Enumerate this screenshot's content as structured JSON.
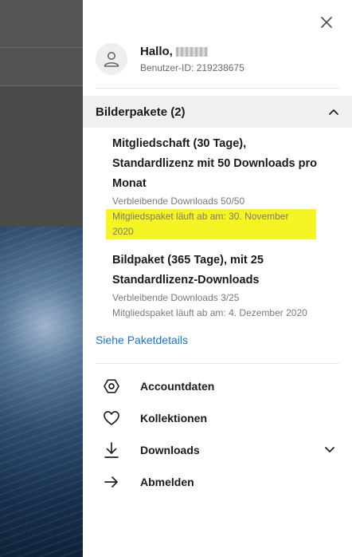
{
  "user": {
    "greeting": "Hallo,",
    "id_text": "Benutzer-ID: 219238675"
  },
  "packages": {
    "title": "Bilderpakete (2)",
    "items": [
      {
        "name": "Mitgliedschaft (30 Tage), Standardlizenz mit 50 Downloads pro Monat",
        "remaining": "Verbleibende Downloads 50/50",
        "expiry": "Mitgliedspaket läuft ab am: 30. November 2020"
      },
      {
        "name": "Bildpaket (365 Tage), mit 25 Standardlizenz-Downloads",
        "remaining": "Verbleibende Downloads 3/25",
        "expiry": "Mitgliedspaket läuft ab am: 4. Dezember 2020"
      }
    ],
    "details_link": "Siehe Paketdetails"
  },
  "menu": [
    {
      "label": "Accountdaten",
      "icon": "hexagon-icon"
    },
    {
      "label": "Kollektionen",
      "icon": "heart-icon"
    },
    {
      "label": "Downloads",
      "icon": "download-icon",
      "expandable": true
    },
    {
      "label": "Abmelden",
      "icon": "arrow-right-icon"
    }
  ],
  "colors": {
    "link": "#1a73c8",
    "highlight": "#f5f524",
    "header_bg": "#f0f0f0"
  }
}
